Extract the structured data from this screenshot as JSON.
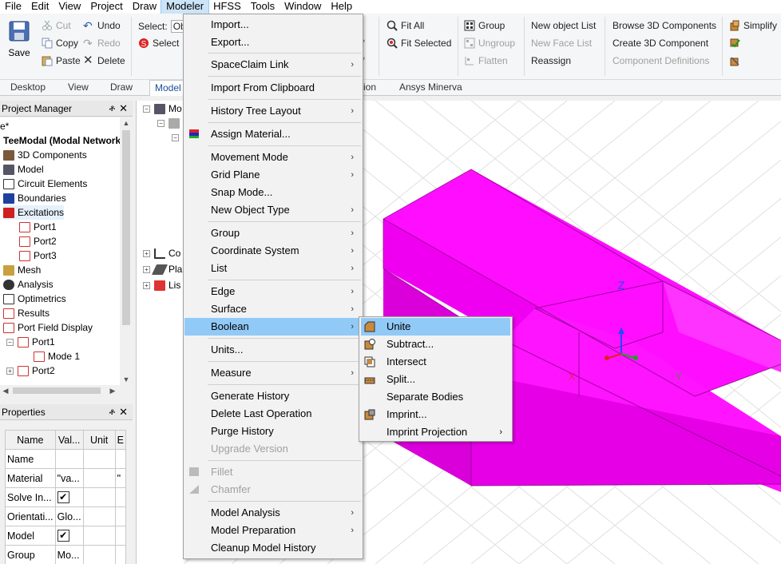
{
  "menubar": {
    "items": [
      "File",
      "Edit",
      "View",
      "Project",
      "Draw",
      "Modeler",
      "HFSS",
      "Tools",
      "Window",
      "Help"
    ],
    "active": "Modeler"
  },
  "ribbon": {
    "save": "Save",
    "cut": "Cut",
    "copy": "Copy",
    "paste": "Paste",
    "undo": "Undo",
    "redo": "Redo",
    "delete": "Delete",
    "select_label": "Select:",
    "select_value": "Ob",
    "select_button": "Select",
    "fit_all": "Fit All",
    "fit_selected": "Fit Selected",
    "group": "Group",
    "ungroup": "Ungroup",
    "flatten": "Flatten",
    "new_object_list": "New object List",
    "new_face_list": "New Face List",
    "reassign": "Reassign",
    "browse_3d": "Browse 3D Components",
    "create_3d": "Create 3D Component",
    "component_defs": "Component Definitions",
    "simplify": "Simplify"
  },
  "ribbon_tabs": [
    "Desktop",
    "View",
    "Draw",
    "Model",
    "ion",
    "Ansys Minerva"
  ],
  "project_manager": {
    "title": "Project Manager",
    "tree": [
      {
        "label": "e*",
        "bold": false
      },
      {
        "label": "TeeModal (Modal Network",
        "bold": true
      },
      {
        "label": "3D Components"
      },
      {
        "label": "Model"
      },
      {
        "label": "Circuit Elements"
      },
      {
        "label": "Boundaries"
      },
      {
        "label": "Excitations"
      },
      {
        "label": "Port1"
      },
      {
        "label": "Port2"
      },
      {
        "label": "Port3"
      },
      {
        "label": "Mesh"
      },
      {
        "label": "Analysis"
      },
      {
        "label": "Optimetrics"
      },
      {
        "label": "Results"
      },
      {
        "label": "Port Field Display"
      },
      {
        "label": "Port1"
      },
      {
        "label": "Mode 1"
      },
      {
        "label": "Port2"
      }
    ]
  },
  "properties": {
    "title": "Properties",
    "headers": [
      "Name",
      "Val...",
      "Unit",
      "E"
    ],
    "rows": [
      {
        "name": "Name",
        "value": ""
      },
      {
        "name": "Material",
        "value": "\"va...",
        "extra": "\""
      },
      {
        "name": "Solve In...",
        "value": "",
        "checked": true
      },
      {
        "name": "Orientati...",
        "value": "Glo..."
      },
      {
        "name": "Model",
        "value": "",
        "checked": true
      },
      {
        "name": "Group",
        "value": "Mo..."
      }
    ]
  },
  "model_tree": {
    "items": [
      "Mo",
      "Co",
      "Pla",
      "Lis"
    ]
  },
  "modeler_menu": {
    "items": [
      {
        "label": "Import..."
      },
      {
        "label": "Export..."
      },
      {
        "label": "SpaceClaim Link",
        "sub": true
      },
      {
        "label": "Import From Clipboard"
      },
      {
        "label": "History Tree Layout",
        "sub": true
      },
      {
        "label": "Assign Material..."
      },
      {
        "label": "Movement Mode",
        "sub": true
      },
      {
        "label": "Grid Plane",
        "sub": true
      },
      {
        "label": "Snap Mode..."
      },
      {
        "label": "New Object Type",
        "sub": true
      },
      {
        "label": "Group",
        "sub": true
      },
      {
        "label": "Coordinate System",
        "sub": true
      },
      {
        "label": "List",
        "sub": true
      },
      {
        "label": "Edge",
        "sub": true
      },
      {
        "label": "Surface",
        "sub": true
      },
      {
        "label": "Boolean",
        "sub": true
      },
      {
        "label": "Units..."
      },
      {
        "label": "Measure",
        "sub": true
      },
      {
        "label": "Generate History"
      },
      {
        "label": "Delete Last Operation"
      },
      {
        "label": "Purge History"
      },
      {
        "label": "Upgrade Version",
        "disabled": true
      },
      {
        "label": "Fillet",
        "disabled": true
      },
      {
        "label": "Chamfer",
        "disabled": true
      },
      {
        "label": "Model Analysis",
        "sub": true
      },
      {
        "label": "Model Preparation",
        "sub": true
      },
      {
        "label": "Cleanup Model History"
      }
    ],
    "highlighted": "Boolean"
  },
  "boolean_submenu": {
    "items": [
      {
        "label": "Unite"
      },
      {
        "label": "Subtract..."
      },
      {
        "label": "Intersect"
      },
      {
        "label": "Split..."
      },
      {
        "label": "Separate Bodies"
      },
      {
        "label": "Imprint..."
      },
      {
        "label": "Imprint Projection",
        "sub": true
      }
    ],
    "highlighted": "Unite"
  },
  "viewport": {
    "axis_z": "Z",
    "axis_x": "X",
    "axis_y": "Y",
    "model_color": "#ff00ff"
  },
  "colors": {
    "menu_highlight": "#91c9f7",
    "active_menubar": "#cce4f7"
  }
}
